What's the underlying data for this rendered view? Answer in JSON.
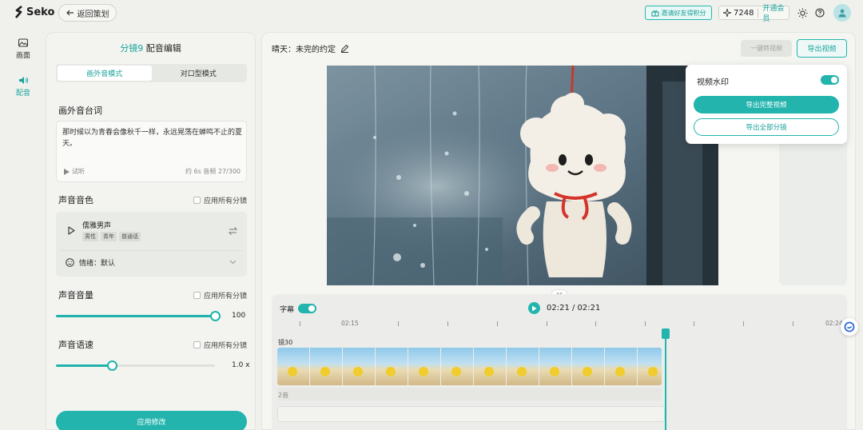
{
  "header": {
    "logo_text": "Seko",
    "back_label": "返回策划",
    "invite_label": "邀请好友得积分",
    "points": "7248",
    "vip_label": "开通会员"
  },
  "rail": {
    "items": [
      {
        "label": "画面",
        "icon": "image-icon",
        "active": false
      },
      {
        "label": "配音",
        "icon": "speaker-icon",
        "active": true
      }
    ]
  },
  "left_panel": {
    "shot_label": "分镜9",
    "title": "配音编辑",
    "tabs": [
      {
        "label": "画外音模式",
        "active": true
      },
      {
        "label": "对口型模式",
        "active": false
      }
    ],
    "script_section": {
      "label": "画外音台词",
      "text": "那时候以为青春会像秋千一样，永远晃荡在蝉鸣不止的夏天。",
      "try_label": "试听",
      "counter": "约 6s 音频 27/300"
    },
    "voice_section": {
      "label": "声音音色",
      "apply_all": "应用所有分镜",
      "voice_name": "儒雅男声",
      "tags": [
        "男性",
        "青年",
        "普通话"
      ],
      "emotion": "情绪：默认"
    },
    "volume_section": {
      "label": "声音音量",
      "apply_all": "应用所有分镜",
      "value": "100",
      "level_percent": 100
    },
    "speed_section": {
      "label": "声音语速",
      "apply_all": "应用所有分镜",
      "value": "1.0 x",
      "level_percent": 35
    },
    "apply_button": "应用修改"
  },
  "main": {
    "doc_title": "晴天：未完的约定",
    "oneclick_label": "一键转视频",
    "export_label": "导出视频",
    "export_popup": {
      "watermark_label": "视频水印",
      "watermark_on": true,
      "export_full": "导出完整视频",
      "export_all_shots": "导出全部分镜"
    }
  },
  "timeline": {
    "subtitle_label": "字幕",
    "subtitle_on": true,
    "time_display": "02:21 / 02:21",
    "ruler_labels": [
      "02:15",
      "02:24"
    ],
    "shot_track_label": "镜30",
    "audio_track_label": "2音"
  },
  "colors": {
    "accent": "#22b4ad",
    "background": "#f0f1ed"
  }
}
